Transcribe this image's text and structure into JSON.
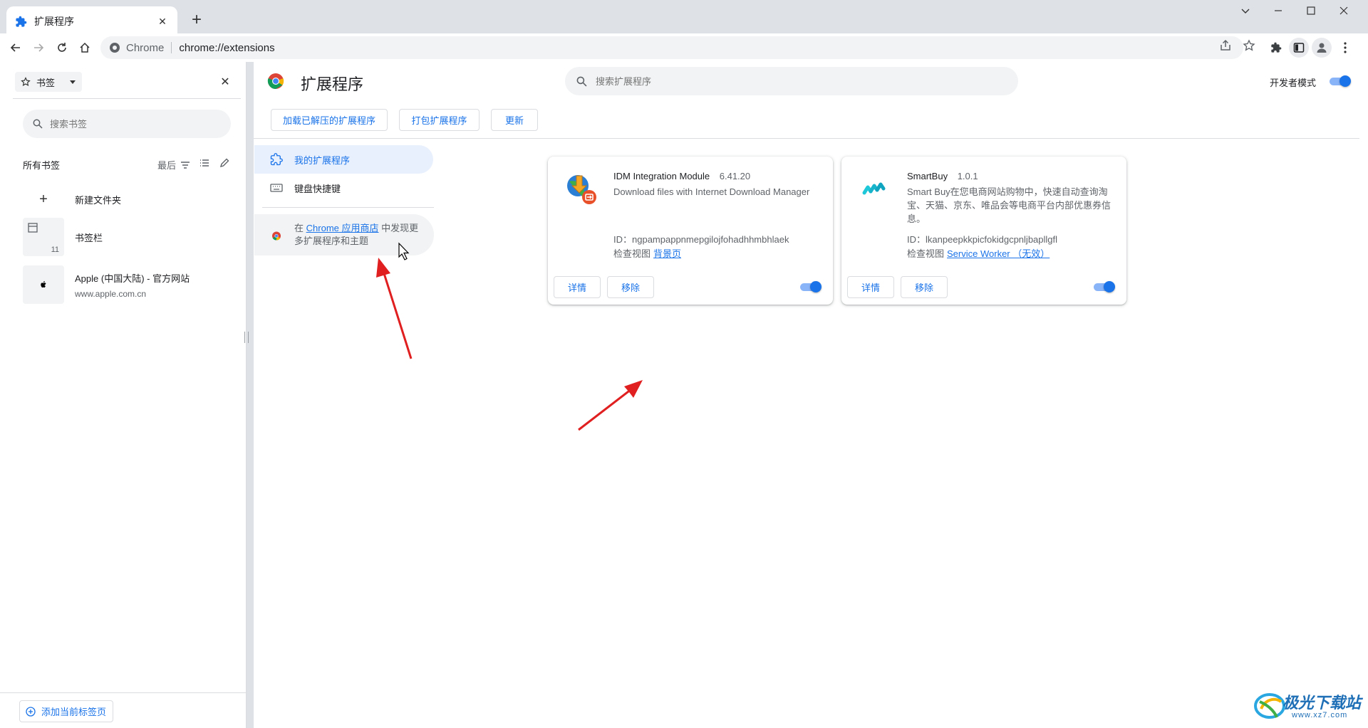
{
  "browser": {
    "tab_title": "扩展程序",
    "omnibox_site": "Chrome",
    "omnibox_url": "chrome://extensions"
  },
  "bookmarks_panel": {
    "selector_label": "书签",
    "search_placeholder": "搜索书签",
    "all_label": "所有书签",
    "sort_label": "最后",
    "items": [
      {
        "title": "新建文件夹",
        "subtitle": ""
      },
      {
        "title": "书签栏",
        "subtitle": "",
        "count": "11"
      },
      {
        "title": "Apple (中国大陆) - 官方网站",
        "subtitle": "www.apple.com.cn"
      }
    ],
    "add_current_tab": "添加当前标签页"
  },
  "extensions": {
    "page_title": "扩展程序",
    "search_placeholder": "搜索扩展程序",
    "dev_mode_label": "开发者模式",
    "dev_mode_on": true,
    "toolbar": {
      "load_unpacked": "加载已解压的扩展程序",
      "pack": "打包扩展程序",
      "update": "更新"
    },
    "nav": {
      "my_extensions": "我的扩展程序",
      "keyboard_shortcuts": "键盘快捷键",
      "webstore_prefix": "在",
      "webstore_link": "Chrome 应用商店",
      "webstore_suffix": "中发现更多扩展程序和主题"
    },
    "cards": [
      {
        "name": "IDM Integration Module",
        "version": "6.41.20",
        "description": "Download files with Internet Download Manager",
        "id_label": "ID：ngpampappnmepgilojfohadhhmbhlaek",
        "inspect_label": "检查视图",
        "inspect_link": "背景页",
        "details": "详情",
        "remove": "移除",
        "enabled": true
      },
      {
        "name": "SmartBuy",
        "version": "1.0.1",
        "description": "Smart Buy在您电商网站购物中，快速自动查询淘宝、天猫、京东、唯品会等电商平台内部优惠券信息。",
        "id_label": "ID：lkanpeepkkpicfokidgcpnljbapllgfl",
        "inspect_label": "检查视图",
        "inspect_link": "Service Worker （无效）",
        "details": "详情",
        "remove": "移除",
        "enabled": true
      }
    ]
  },
  "watermark": {
    "title": "极光下载站",
    "url": "www.xz7.com"
  },
  "colors": {
    "accent": "#1a73e8",
    "annotation_arrow": "#e02020"
  }
}
